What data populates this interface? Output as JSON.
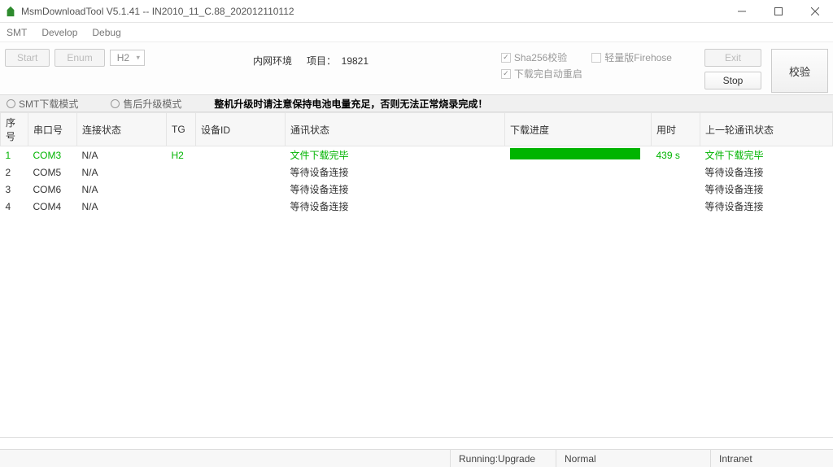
{
  "window": {
    "title": "MsmDownloadTool V5.1.41 -- IN2010_11_C.88_202012110112"
  },
  "menu": {
    "smt": "SMT",
    "develop": "Develop",
    "debug": "Debug"
  },
  "toolbar": {
    "start": "Start",
    "enum": "Enum",
    "mode_select": "H2",
    "env_label": "内网环境",
    "project_label": "项目：",
    "project_value": "19821",
    "chk_sha": "Sha256校验",
    "chk_firehose": "轻量版Firehose",
    "chk_reboot": "下载完自动重启",
    "exit": "Exit",
    "stop": "Stop",
    "verify": "校验"
  },
  "modebar": {
    "radio1": "SMT下载模式",
    "radio2": "售后升级模式",
    "warning": "整机升级时请注意保持电池电量充足，否则无法正常烧录完成！"
  },
  "columns": {
    "idx": "序号",
    "com": "串口号",
    "conn": "连接状态",
    "tg": "TG",
    "devid": "设备ID",
    "comm": "通讯状态",
    "prog": "下载进度",
    "time": "用时",
    "last": "上一轮通讯状态"
  },
  "rows": [
    {
      "idx": "1",
      "com": "COM3",
      "conn": "N/A",
      "tg": "H2",
      "devid": "",
      "comm": "文件下载完毕",
      "prog": "full",
      "time": "439 s",
      "last": "文件下载完毕",
      "cls": "green"
    },
    {
      "idx": "2",
      "com": "COM5",
      "conn": "N/A",
      "tg": "",
      "devid": "",
      "comm": "等待设备连接",
      "prog": "",
      "time": "",
      "last": "等待设备连接",
      "cls": ""
    },
    {
      "idx": "3",
      "com": "COM6",
      "conn": "N/A",
      "tg": "",
      "devid": "",
      "comm": "等待设备连接",
      "prog": "",
      "time": "",
      "last": "等待设备连接",
      "cls": ""
    },
    {
      "idx": "4",
      "com": "COM4",
      "conn": "N/A",
      "tg": "",
      "devid": "",
      "comm": "等待设备连接",
      "prog": "",
      "time": "",
      "last": "等待设备连接",
      "cls": ""
    }
  ],
  "status": {
    "running": "Running:Upgrade",
    "normal": "Normal",
    "intranet": "Intranet"
  }
}
